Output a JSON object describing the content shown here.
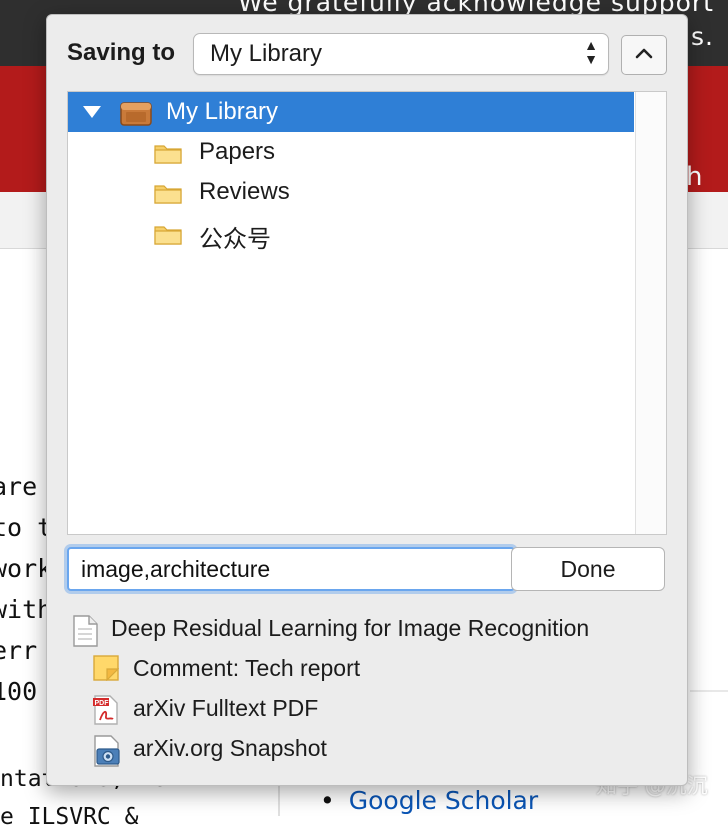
{
  "background": {
    "ack_text": "We gratefully acknowledge support from                                  ns.",
    "search_fragment": "h",
    "left_text": [
      "are",
      "to th",
      "work",
      "with",
      " err",
      " 100"
    ],
    "bottom_left": [
      "ntations, we",
      "e ILSVRC &"
    ],
    "scholar_link": "Google Scholar",
    "watermark": "知乎 @沉沉"
  },
  "popup": {
    "saving_label": "Saving to",
    "library_select": {
      "value": "My Library",
      "arrows": "▲▼"
    },
    "tree": {
      "root": "My Library",
      "collections": [
        "Papers",
        "Reviews",
        "公众号"
      ]
    },
    "tags_input": {
      "value": "image,architecture"
    },
    "done_label": "Done",
    "items": {
      "main": "Deep Residual Learning for Image Recognition",
      "attachments": [
        {
          "label": "Comment: Tech report",
          "icon": "note-icon"
        },
        {
          "label": "arXiv Fulltext PDF",
          "icon": "pdf-icon"
        },
        {
          "label": "arXiv.org Snapshot",
          "icon": "snapshot-icon"
        }
      ]
    }
  },
  "colors": {
    "selection": "#2f7fd6",
    "arxiv_red": "#b31b1b",
    "focus_ring": "#6aa6ee",
    "link": "#0a55b5"
  }
}
